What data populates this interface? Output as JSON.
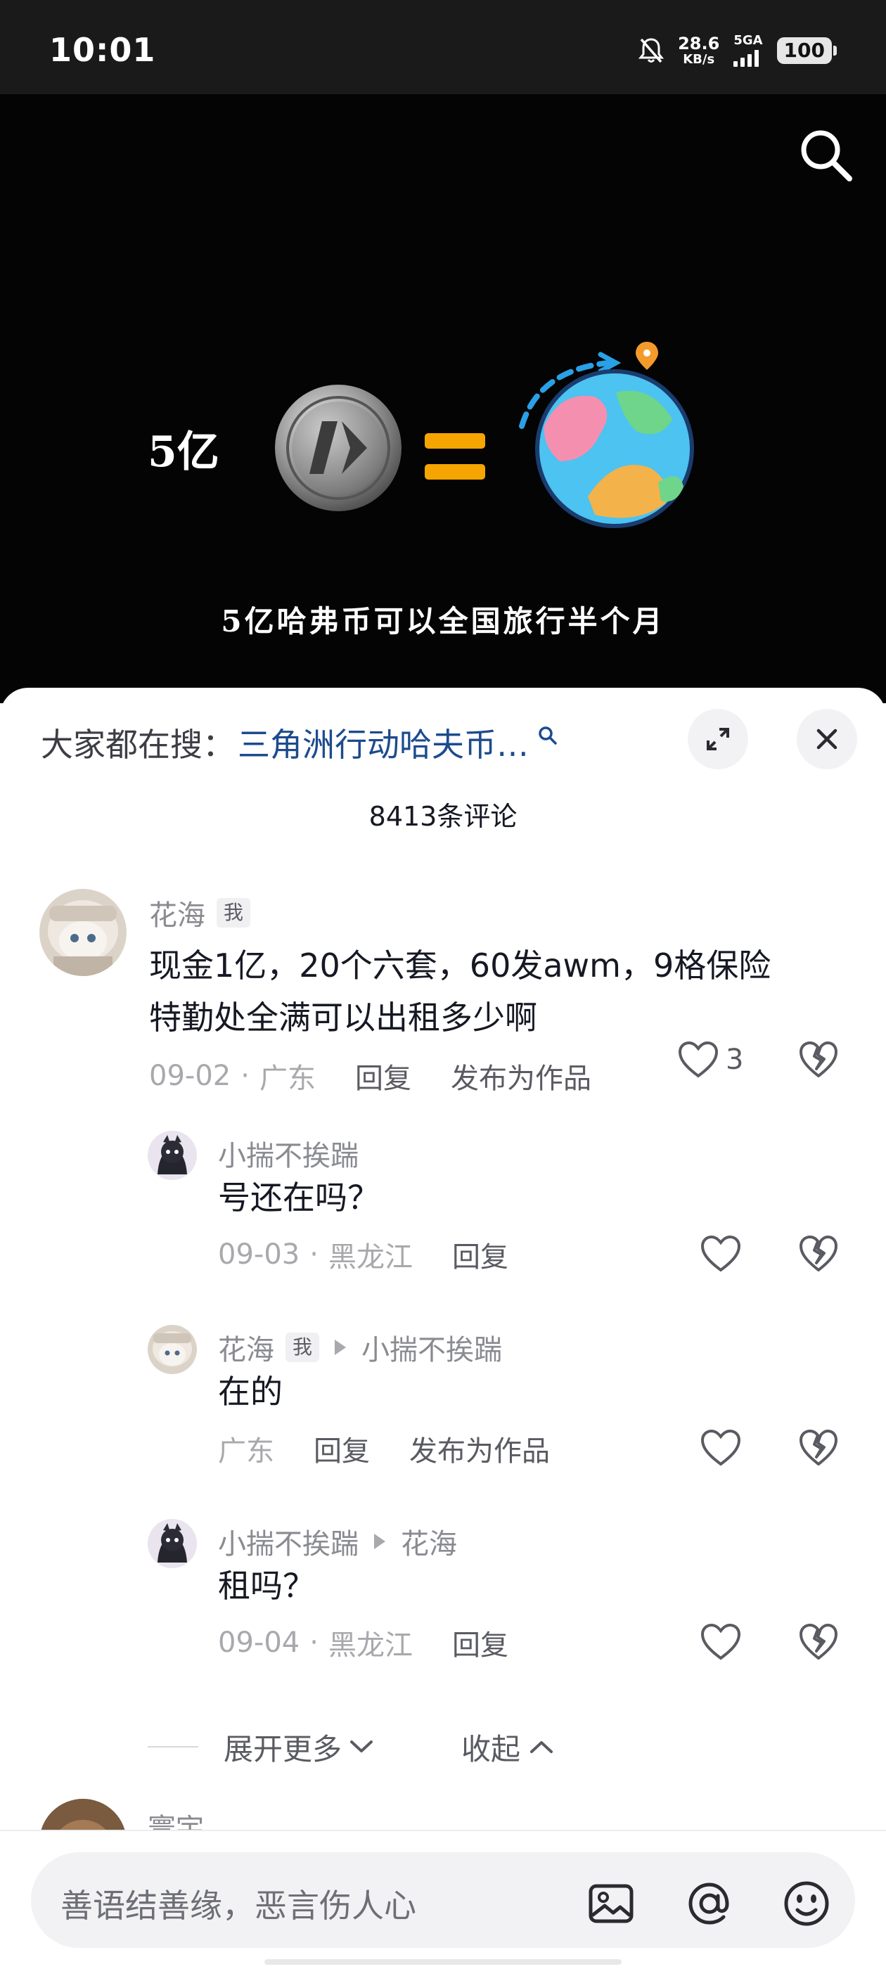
{
  "status_bar": {
    "time": "10:01",
    "net_speed_value": "28.6",
    "net_speed_unit": "KB/s",
    "network_type": "5GA",
    "battery": "100",
    "icons": [
      "mute-icon",
      "signal-icon",
      "battery-icon"
    ]
  },
  "video": {
    "price_text": "5亿",
    "caption": "5亿哈弗币可以全国旅行半个月",
    "icons": [
      "search-icon",
      "coin-icon",
      "equals-icon",
      "globe-icon"
    ]
  },
  "comments_panel": {
    "hot_search_label": "大家都在搜：",
    "hot_search_query": "三角洲行动哈夫币…",
    "comment_count": "8413条评论",
    "comments": [
      {
        "author": "花海",
        "me_tag": "我",
        "text_line1": "现金1亿，20个六套，60发awm，9格保险",
        "text_line2": "特勤处全满可以出租多少啊",
        "date": "09-02",
        "location": "广东",
        "reply_label": "回复",
        "publish_label": "发布为作品",
        "likes": "3",
        "replies": [
          {
            "author": "小揣不挨踹",
            "text": "号还在吗？",
            "date": "09-03",
            "location": "黑龙江",
            "reply_label": "回复"
          },
          {
            "author": "花海",
            "me_tag": "我",
            "reply_to": "小揣不挨踹",
            "text": "在的",
            "location": "广东",
            "reply_label": "回复",
            "publish_label": "发布为作品"
          },
          {
            "author": "小揣不挨踹",
            "reply_to": "花海",
            "text": "租吗？",
            "date": "09-04",
            "location": "黑龙江",
            "reply_label": "回复"
          }
        ],
        "expand_more": "展开更多",
        "collapse": "收起"
      },
      {
        "author": "寰宇"
      }
    ]
  },
  "input_bar": {
    "placeholder": "善语结善缘，恶言伤人心",
    "icons": [
      "image-icon",
      "at-icon",
      "emoji-icon"
    ]
  },
  "colors": {
    "link": "#1c4b8e",
    "sheet_bg": "#ffffff",
    "video_bg": "#040404",
    "accent_orange": "#f6a500"
  }
}
